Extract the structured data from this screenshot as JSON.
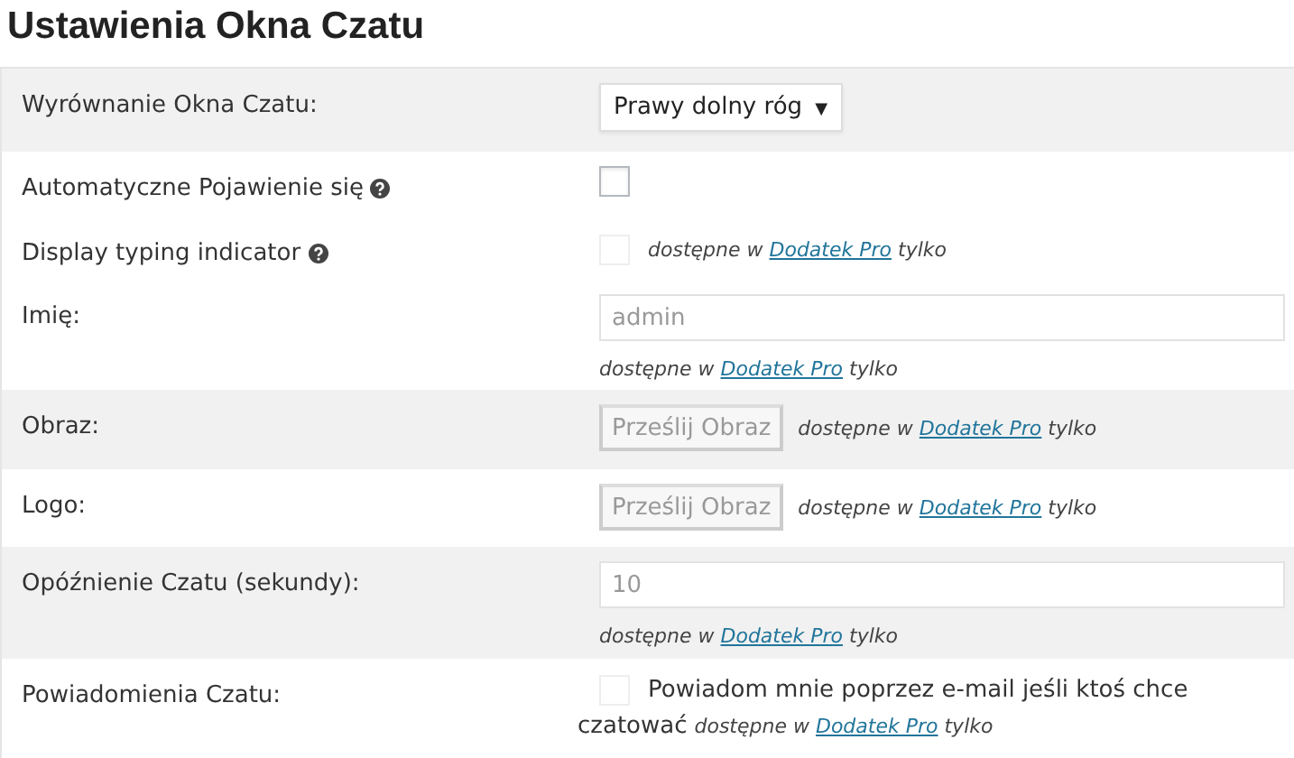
{
  "title": "Ustawienia Okna Czatu",
  "rows": [
    {
      "label": "Wyrównanie Okna Czatu:",
      "help": false,
      "shaded": true,
      "kind": "select",
      "value": "Prawy dolny róg",
      "caret": "▼"
    },
    {
      "label": "Automatyczne Pojawienie się",
      "help": true,
      "shaded": false,
      "kind": "checkbox",
      "checked": false,
      "disabled": false
    },
    {
      "label": "Display typing indicator",
      "help": true,
      "shaded": false,
      "kind": "checkbox",
      "checked": false,
      "disabled": true,
      "note": {
        "prefix": "dostępne w",
        "link": "Dodatek Pro",
        "suffix": "tylko"
      }
    },
    {
      "label": "Imię:",
      "help": false,
      "shaded": false,
      "kind": "text",
      "value": "admin",
      "note": {
        "prefix": "dostępne w",
        "link": "Dodatek Pro",
        "suffix": "tylko"
      }
    },
    {
      "label": "Obraz:",
      "help": false,
      "shaded": true,
      "kind": "upload",
      "button": "Prześlij Obraz",
      "note": {
        "prefix": "dostępne w",
        "link": "Dodatek Pro",
        "suffix": "tylko"
      }
    },
    {
      "label": "Logo:",
      "help": false,
      "shaded": false,
      "kind": "upload",
      "button": "Prześlij Obraz",
      "note": {
        "prefix": "dostępne w",
        "link": "Dodatek Pro",
        "suffix": "tylko"
      }
    },
    {
      "label": "Opóźnienie Czatu (sekundy):",
      "help": false,
      "shaded": true,
      "kind": "text",
      "value": "10",
      "note": {
        "prefix": "dostępne w",
        "link": "Dodatek Pro",
        "suffix": "tylko"
      }
    },
    {
      "label": "Powiadomienia Czatu:",
      "help": false,
      "shaded": false,
      "kind": "checkbox_text",
      "checked": false,
      "disabled": true,
      "text_first": "Powiadom mnie poprzez e-mail jeśli ktoś chce",
      "text_second": "czatować",
      "note": {
        "prefix": "dostępne w",
        "link": "Dodatek Pro",
        "suffix": "tylko"
      }
    }
  ]
}
